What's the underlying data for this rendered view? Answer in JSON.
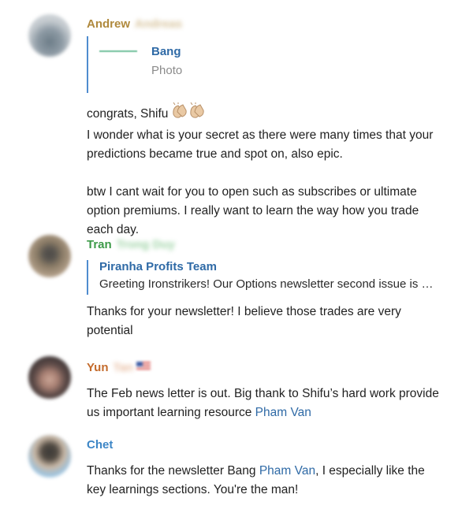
{
  "messages": [
    {
      "sender_first": "Andrew",
      "sender_rest": "Andreas",
      "sender_color": "#b08a3e",
      "reply": {
        "author": "Bang",
        "text": "Photo"
      },
      "text_lines": [
        "congrats, Shifu",
        "I wonder what is your secret as there were many times that your",
        "predictions became true and spot on, also epic."
      ],
      "text_lines_2": [
        "btw I cant wait for you to open such as subscribes or ultimate",
        "option premiums. I really want to learn the way how you trade",
        "each day."
      ]
    },
    {
      "sender_first": "Tran",
      "sender_rest": "Trong Duy",
      "sender_color": "#3c9a48",
      "reply": {
        "author": "Piranha Profits Team",
        "text": "Greeting Ironstrikers! Our Options newsletter second issue is …"
      },
      "text_lines": [
        "Thanks for your newsletter! I believe those trades are very",
        "potential"
      ]
    },
    {
      "sender_first": "Yun",
      "sender_rest": "Tan",
      "sender_color": "#c46b2c",
      "text_lines": [
        "The Feb news letter is out. Big thank to Shifu’s hard work provide"
      ],
      "last_line_prefix": "us important learning resource ",
      "mention": "Pham Van"
    },
    {
      "sender_first": "Chet",
      "sender_rest": "",
      "sender_color": "#3d86c6",
      "line1_prefix": "Thanks for the newsletter Bang ",
      "mention": "Pham Van",
      "line1_suffix": ", I especially like the",
      "text_lines": [
        "key learnings sections. You're the man!"
      ]
    }
  ],
  "colors": {
    "link": "#2f6aa6",
    "reply_bar": "#4f8ccf"
  }
}
